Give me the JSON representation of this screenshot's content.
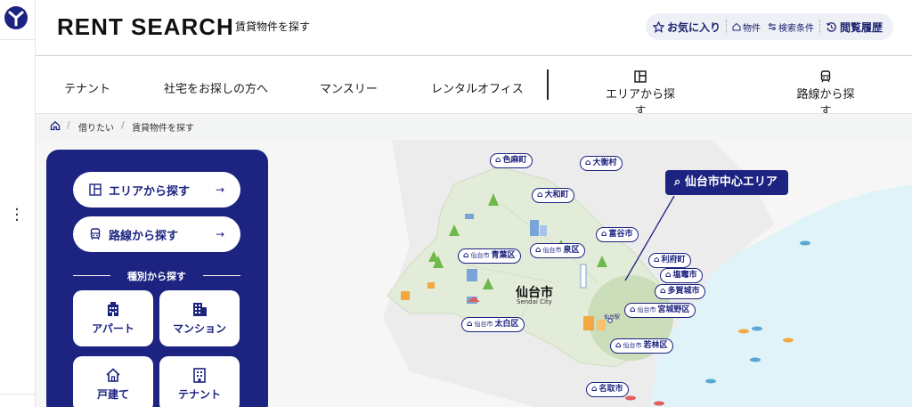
{
  "header": {
    "brand": "RENT SEARCH",
    "subtitle": "賃貸物件を探す",
    "util": {
      "favorites": "お気に入り",
      "property": "物件",
      "conditions": "検索条件",
      "history": "閲覧履歴"
    }
  },
  "nav": {
    "items": [
      "テナント",
      "社宅をお探しの方へ",
      "マンスリー",
      "レンタルオフィス"
    ],
    "area": "エリアから探す",
    "line": "路線から探す"
  },
  "breadcrumb": [
    "借りたい",
    "賃貸物件を探す"
  ],
  "panel": {
    "area_button": "エリアから探す",
    "line_button": "路線から探す",
    "kind_title": "種別から探す",
    "kinds": [
      "アパート",
      "マンション",
      "戸建て",
      "テナント"
    ],
    "arrow": "→"
  },
  "map": {
    "callout": "仙台市中心エリア",
    "city": "仙台市",
    "city_en": "Sendai City",
    "station": "仙台駅",
    "areas": {
      "shikama": "色麻町",
      "ohira": "大衡村",
      "taiwa": "大和町",
      "tomiya": "富谷市",
      "rifu": "利府町",
      "shiogama": "塩竈市",
      "tagajo": "多賀城市",
      "natori": "名取市",
      "prefix": "仙台市",
      "aoba": "青葉区",
      "izumi": "泉区",
      "taihaku": "太白区",
      "miyagino": "宮城野区",
      "wakabayashi": "若林区"
    }
  },
  "colors": {
    "navy": "#1c2380",
    "sea": "#dff3f8",
    "land": "#e3ecd9",
    "center": "#c9dcb6"
  }
}
